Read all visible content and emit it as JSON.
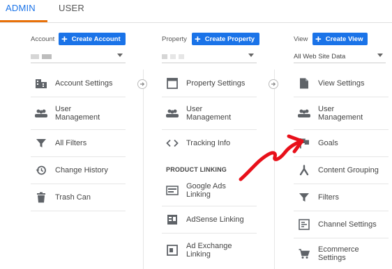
{
  "tabs": {
    "admin": "ADMIN",
    "user": "USER"
  },
  "account": {
    "label": "Account",
    "create_button": "Create Account",
    "selected": "",
    "items": [
      {
        "label": "Account Settings",
        "icon": "building-icon"
      },
      {
        "label": "User Management",
        "icon": "people-icon"
      },
      {
        "label": "All Filters",
        "icon": "filter-icon"
      },
      {
        "label": "Change History",
        "icon": "history-icon"
      },
      {
        "label": "Trash Can",
        "icon": "trash-icon"
      }
    ]
  },
  "property": {
    "label": "Property",
    "create_button": "Create Property",
    "selected": "",
    "items": [
      {
        "label": "Property Settings",
        "icon": "window-icon"
      },
      {
        "label": "User Management",
        "icon": "people-icon"
      },
      {
        "label": "Tracking Info",
        "icon": "code-icon"
      }
    ],
    "section_title": "PRODUCT LINKING",
    "linking_items": [
      {
        "label": "Google Ads Linking",
        "icon": "ads-icon"
      },
      {
        "label": "AdSense Linking",
        "icon": "adsense-icon"
      },
      {
        "label": "Ad Exchange Linking",
        "icon": "ad-exchange-icon"
      }
    ]
  },
  "view": {
    "label": "View",
    "create_button": "Create View",
    "selected": "All Web Site Data",
    "items": [
      {
        "label": "View Settings",
        "icon": "document-icon"
      },
      {
        "label": "User Management",
        "icon": "people-icon"
      },
      {
        "label": "Goals",
        "icon": "flag-icon"
      },
      {
        "label": "Content Grouping",
        "icon": "grouping-icon"
      },
      {
        "label": "Filters",
        "icon": "filter-icon"
      },
      {
        "label": "Channel Settings",
        "icon": "channel-icon"
      },
      {
        "label": "Ecommerce Settings",
        "icon": "cart-icon"
      }
    ]
  },
  "colors": {
    "accent": "#1a73e8",
    "tab_underline": "#e8710a",
    "annotation_arrow": "#e8101a"
  }
}
